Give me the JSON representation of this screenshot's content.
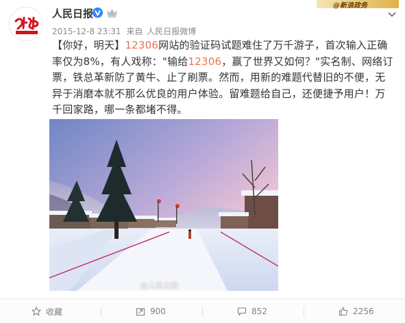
{
  "post": {
    "author": "人民日报",
    "timestamp": "2015-12-8 23:31",
    "source_prefix": "来自",
    "source": "人民日报微博",
    "text_parts": [
      {
        "t": "【你好，明天】",
        "hl": false
      },
      {
        "t": "12306",
        "hl": true
      },
      {
        "t": "网站的验证码试题难住了万千游子，首次输入正确率仅为8%，有人戏称：\"输给",
        "hl": false
      },
      {
        "t": "12306",
        "hl": true
      },
      {
        "t": "，赢了世界又如何？\"实名制、网络订票，铁总革新防了黄牛、止了刷票。然而，用新的难题代替旧的不便，无异于消磨本就不那么优良的用户体验。留难题给自己，还便捷予用户！万千回家路，哪一条都堵不得。",
        "hl": false
      }
    ],
    "image_watermark": "@人民日报",
    "corner_banner": "@新浪政务"
  },
  "actions": {
    "favorite_label": "收藏",
    "repost_count": "900",
    "comment_count": "852",
    "like_count": "2256"
  },
  "colors": {
    "highlight": "#eb7350",
    "verified_badge": "#2f89ff",
    "meta_text": "#8a8a8a"
  },
  "icons": {
    "avatar": "people-daily-logo",
    "verified": "verified-v-icon",
    "member": "crown-icon",
    "menu": "chevron-down-icon",
    "favorite": "star-icon",
    "repost": "repost-icon",
    "comment": "comment-icon",
    "like": "thumbs-up-icon"
  }
}
